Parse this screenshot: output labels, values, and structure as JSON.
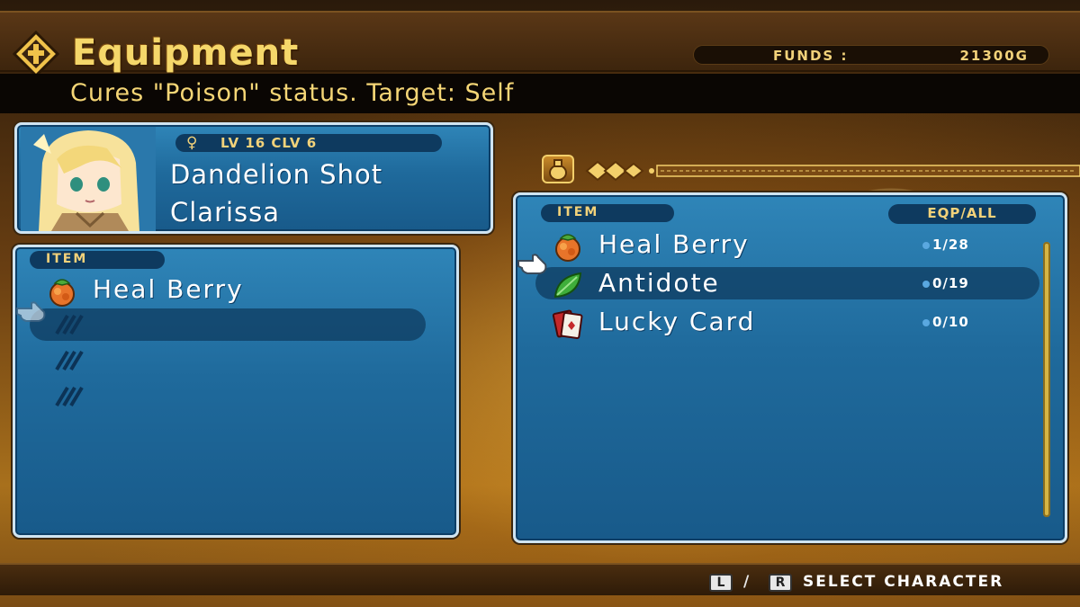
{
  "header": {
    "title": "Equipment",
    "funds_label": "FUNDS :",
    "funds_value": "21300G"
  },
  "description": "Cures \"Poison\" status.  Target: Self",
  "character": {
    "gender_icon": "female-icon",
    "level_text": "LV 16  CLV 6",
    "class_name": "Dandelion Shot",
    "name": "Clarissa"
  },
  "equipped": {
    "header": "ITEM",
    "items": [
      {
        "name": "Heal Berry",
        "icon": "heal-berry-icon"
      }
    ],
    "empty_slots": 3
  },
  "inventory": {
    "header": "ITEM",
    "count_header": "EQP/ALL",
    "items": [
      {
        "name": "Heal Berry",
        "icon": "heal-berry-icon",
        "count": "1/28"
      },
      {
        "name": "Antidote",
        "icon": "antidote-leaf-icon",
        "count": "0/19"
      },
      {
        "name": "Lucky Card",
        "icon": "lucky-card-icon",
        "count": "0/10"
      }
    ],
    "selected_index": 1
  },
  "controls": {
    "key_l": "L",
    "slash": "/",
    "key_r": "R",
    "hint": "SELECT  CHARACTER"
  },
  "colors": {
    "gold_text": "#f2d27a",
    "panel_blue": "#1f6a9c",
    "panel_border": "#cfe4f2"
  }
}
